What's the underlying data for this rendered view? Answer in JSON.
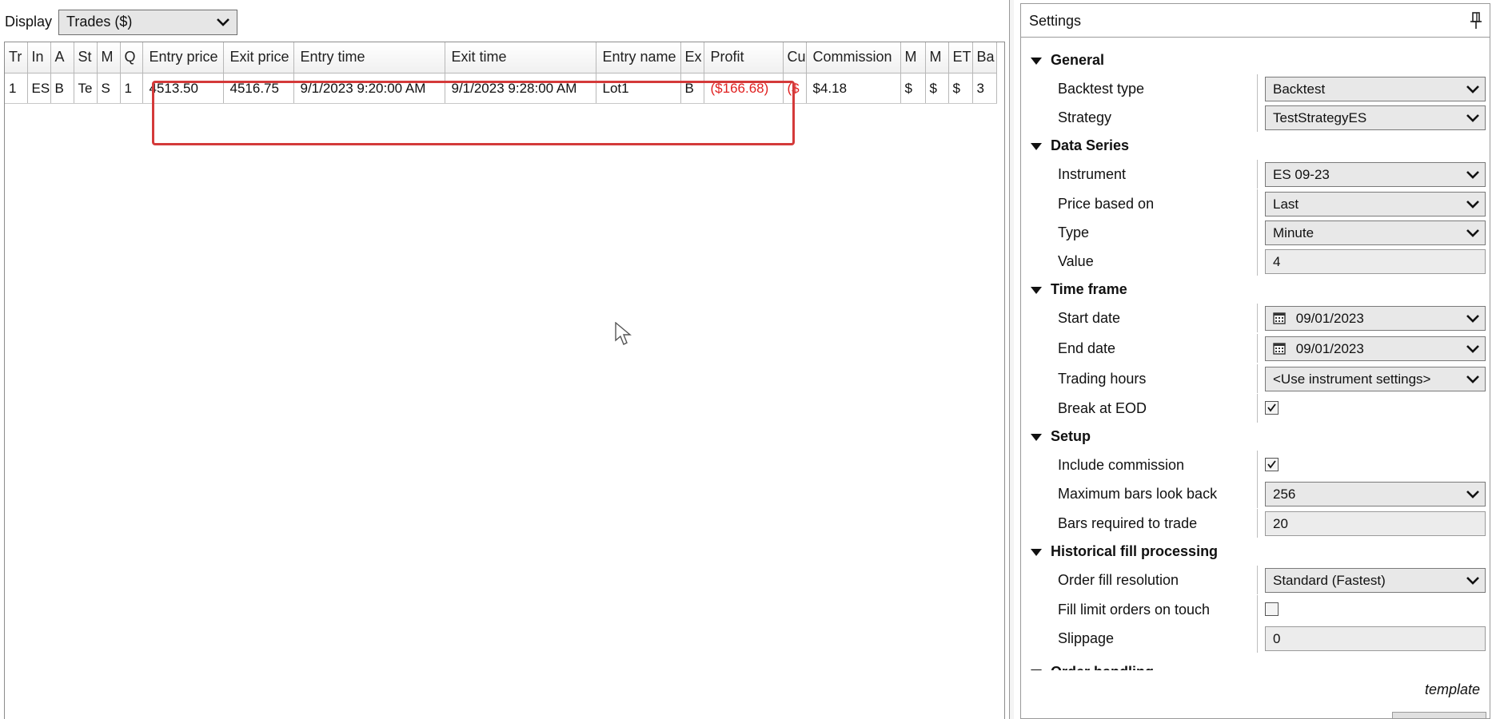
{
  "display": {
    "label": "Display",
    "selected": "Trades ($)"
  },
  "table": {
    "headers": [
      "Tr",
      "In",
      "A",
      "St",
      "M",
      "Q",
      "Entry price",
      "Exit price",
      "Entry time",
      "Exit time",
      "Entry name",
      "Ex",
      "Profit",
      "Cu",
      "Commission",
      "M",
      "M",
      "ET",
      "Ba"
    ],
    "rows": [
      [
        "1",
        "ES",
        "B",
        "Te",
        "S",
        "1",
        "4513.50",
        "4516.75",
        "9/1/2023 9:20:00 AM",
        "9/1/2023 9:28:00 AM",
        "Lot1",
        "B",
        "($166.68)",
        "($",
        "$4.18",
        "$",
        "$",
        "$",
        "3"
      ]
    ],
    "negative_color": "#e02020"
  },
  "settings": {
    "title": "Settings",
    "template_label": "template",
    "categories": {
      "general": "General",
      "data_series": "Data Series",
      "time_frame": "Time frame",
      "setup": "Setup",
      "historical_fill": "Historical fill processing",
      "order_handling": "Order handling"
    },
    "props": {
      "backtest_type": {
        "label": "Backtest type",
        "value": "Backtest"
      },
      "strategy": {
        "label": "Strategy",
        "value": "TestStrategyES"
      },
      "instrument": {
        "label": "Instrument",
        "value": "ES 09-23"
      },
      "price_based_on": {
        "label": "Price based on",
        "value": "Last"
      },
      "type": {
        "label": "Type",
        "value": "Minute"
      },
      "value": {
        "label": "Value",
        "value": "4"
      },
      "start_date": {
        "label": "Start date",
        "value": "09/01/2023"
      },
      "end_date": {
        "label": "End date",
        "value": "09/01/2023"
      },
      "trading_hours": {
        "label": "Trading hours",
        "value": "<Use instrument settings>"
      },
      "break_at_eod": {
        "label": "Break at EOD",
        "checked": true
      },
      "include_commission": {
        "label": "Include commission",
        "checked": true
      },
      "max_bars_look_back": {
        "label": "Maximum bars look back",
        "value": "256"
      },
      "bars_required": {
        "label": "Bars required to trade",
        "value": "20"
      },
      "order_fill_resolution": {
        "label": "Order fill resolution",
        "value": "Standard (Fastest)"
      },
      "fill_limit_on_touch": {
        "label": "Fill limit orders on touch",
        "checked": false
      },
      "slippage": {
        "label": "Slippage",
        "value": "0"
      }
    }
  },
  "colors": {
    "highlight": "#d43a3a"
  }
}
